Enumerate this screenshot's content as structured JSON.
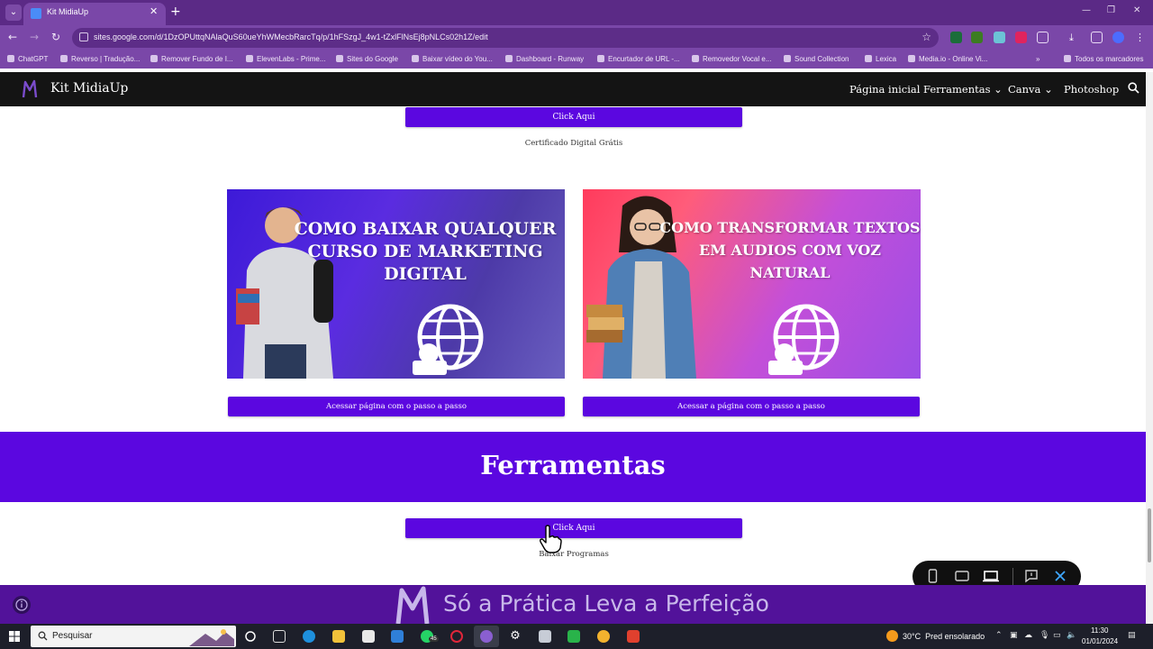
{
  "browser": {
    "tab_title": "Kit MidiaUp",
    "url": "sites.google.com/d/1DzOPUttqNAlaQuS60ueYhWMecbRarcTq/p/1hFSzgJ_4w1-tZxlFlNsEj8pNLCs02h1Z/edit",
    "bookmarks": [
      "ChatGPT",
      "Reverso | Tradução...",
      "Remover Fundo de I...",
      "ElevenLabs - Prime...",
      "Sites do Google",
      "Baixar vídeo do You...",
      "Dashboard - Runway",
      "Encurtador de URL -...",
      "Removedor Vocal e...",
      "Sound Collection",
      "Lexica",
      "Media.io - Online Vi..."
    ],
    "all_bookmarks": "Todos os marcadores"
  },
  "site": {
    "name": "Kit MidiaUp",
    "nav": [
      "Página inicial",
      "Ferramentas",
      "Canva",
      "Photoshop"
    ]
  },
  "content": {
    "top_button": "Click Aqui",
    "top_caption": "Certificado Digital Grátis",
    "banner_left_title": "COMO BAIXAR QUALQUER CURSO DE MARKETING DIGITAL",
    "banner_right_title": "COMO TRANSFORMAR TEXTOS EM AUDIOS COM VOZ NATURAL",
    "btn_left": "Acessar página com o passo a passo",
    "btn_right": "Acessar a página com o passo a passo",
    "tools_heading": "Ferramentas",
    "tools_button": "Click Aqui",
    "tools_caption": "Baixar Programas",
    "footer_text": "Só a Prática Leva a Perfeição"
  },
  "taskbar": {
    "search_placeholder": "Pesquisar",
    "whatsapp_badge": "45",
    "weather": "30°C",
    "weather_desc": "Pred ensolarado",
    "time": "11:30",
    "date": "01/01/2024"
  },
  "colors": {
    "accent": "#5b07e0",
    "browser_frame": "#7a47a8",
    "header_bg": "#141414",
    "footer_bg": "#52129a"
  }
}
